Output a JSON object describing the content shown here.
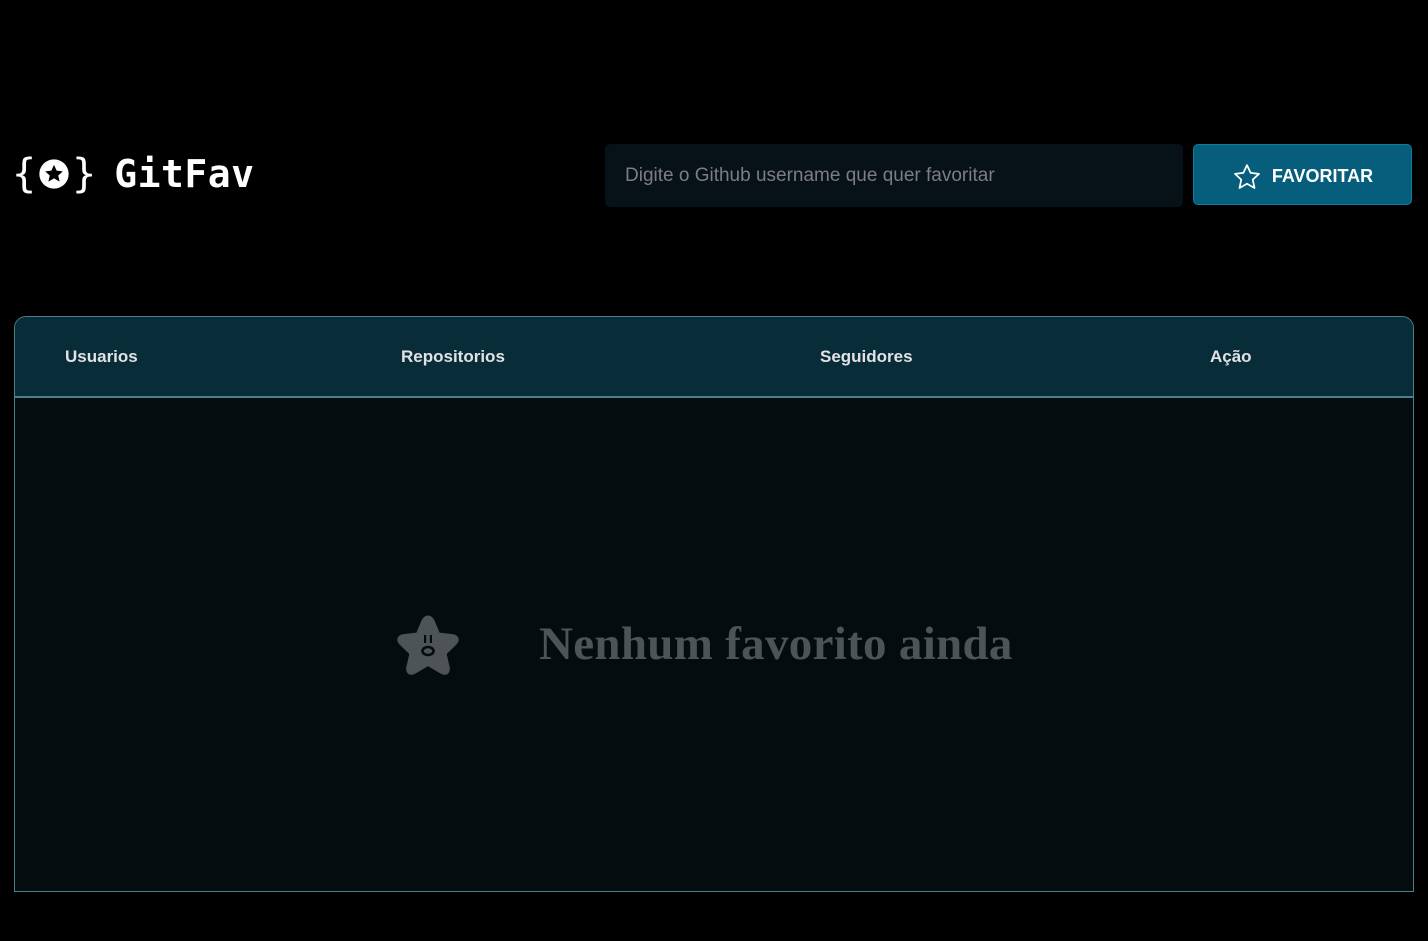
{
  "header": {
    "logo_left_brace": "{",
    "logo_right_brace": "}",
    "logo_text": "GitFav",
    "search_placeholder": "Digite o Github username que quer favoritar",
    "search_value": "",
    "favorite_button_label": "FAVORITAR",
    "favorite_button_icon": "star-outline-icon"
  },
  "table": {
    "columns": [
      "Usuarios",
      "Repositorios",
      "Seguidores",
      "Ação"
    ],
    "rows": []
  },
  "empty_state": {
    "icon": "surprised-star-icon",
    "message": "Nenhum favorito ainda"
  },
  "colors": {
    "background": "#000000",
    "input_background": "#061217",
    "button_background": "#065e7c",
    "table_header_background": "#092d38",
    "table_body_background": "#050c10",
    "border": "#4a808c",
    "empty_text": "#4e5455"
  }
}
